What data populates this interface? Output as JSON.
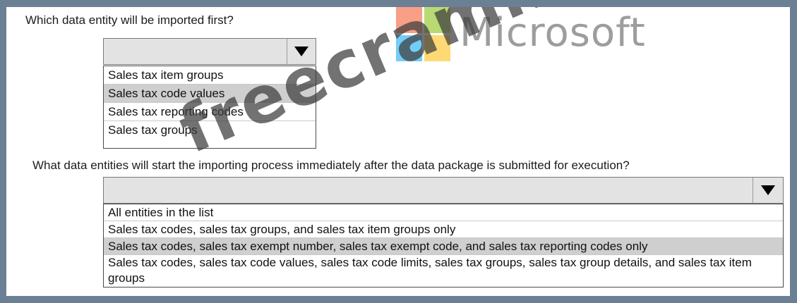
{
  "questions": [
    {
      "prompt": "Which data entity will be imported first?",
      "options": [
        "Sales tax item groups",
        "Sales tax code values",
        "Sales tax reporting codes",
        "Sales tax groups"
      ],
      "highlighted_index": 1
    },
    {
      "prompt": "What data entities will start the importing process immediately after the data package is submitted for execution?",
      "options": [
        "All entities in the list",
        "Sales tax codes, sales tax groups, and sales tax item groups only",
        "Sales tax codes, sales tax exempt number, sales tax exempt code, and sales tax reporting codes only",
        "Sales tax codes, sales tax code values, sales tax code limits, sales tax groups, sales tax group details, and sales tax item groups"
      ],
      "highlighted_index": 2
    }
  ],
  "logo": {
    "word": "Microsoft",
    "colors": [
      "#f25022",
      "#7fba00",
      "#00a4ef",
      "#ffb900"
    ]
  },
  "watermark": "freecram.net"
}
